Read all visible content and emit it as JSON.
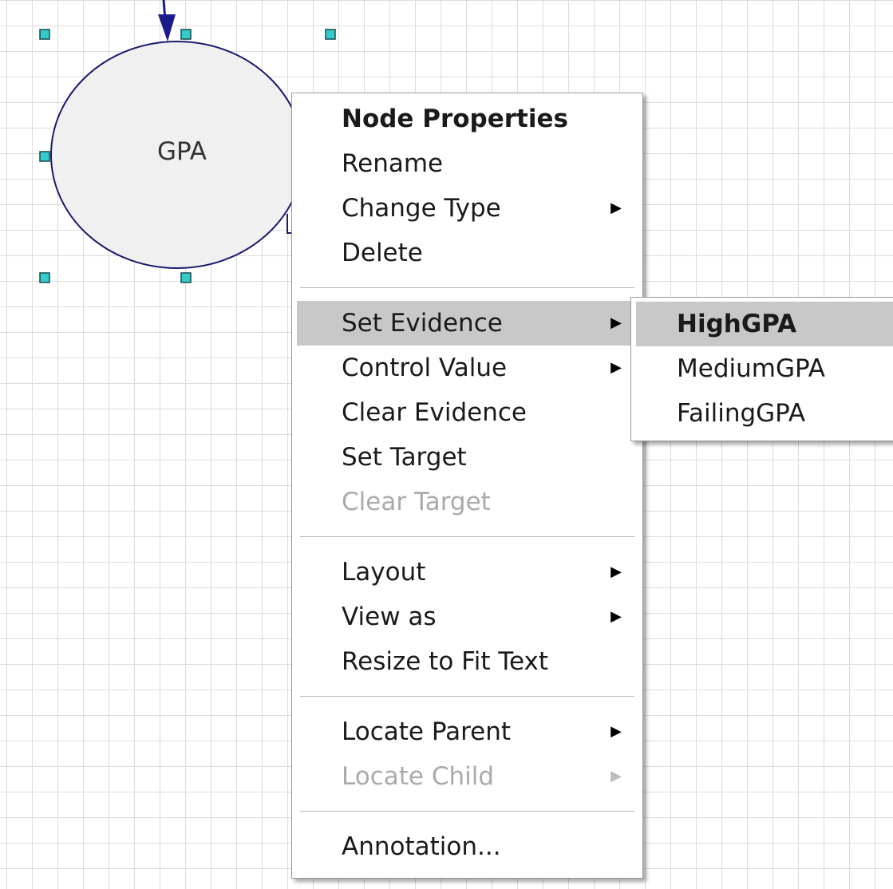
{
  "node": {
    "label": "GPA"
  },
  "context_menu": {
    "groups": [
      [
        {
          "label": "Node Properties",
          "bold": true
        },
        {
          "label": "Rename"
        },
        {
          "label": "Change Type",
          "submenu": true
        },
        {
          "label": "Delete"
        }
      ],
      [
        {
          "label": "Set Evidence",
          "submenu": true,
          "highlighted": true
        },
        {
          "label": "Control Value",
          "submenu": true
        },
        {
          "label": "Clear Evidence"
        },
        {
          "label": "Set Target"
        },
        {
          "label": "Clear Target",
          "disabled": true
        }
      ],
      [
        {
          "label": "Layout",
          "submenu": true
        },
        {
          "label": "View as",
          "submenu": true
        },
        {
          "label": "Resize to Fit Text"
        }
      ],
      [
        {
          "label": "Locate Parent",
          "submenu": true
        },
        {
          "label": "Locate Child",
          "submenu": true,
          "disabled": true
        }
      ],
      [
        {
          "label": "Annotation..."
        }
      ]
    ]
  },
  "submenu": {
    "items": [
      {
        "label": "HighGPA",
        "highlighted": true
      },
      {
        "label": "MediumGPA"
      },
      {
        "label": "FailingGPA"
      }
    ]
  },
  "icons": {
    "submenu_arrow": "submenu-arrow-icon"
  },
  "colors": {
    "node_fill": "#f0f0f0",
    "node_stroke": "#1a1a6e",
    "handle_fill": "#33cccc",
    "edge": "#1a1a8c",
    "highlight": "#c8c8c8",
    "disabled_text": "#aaaaaa"
  }
}
